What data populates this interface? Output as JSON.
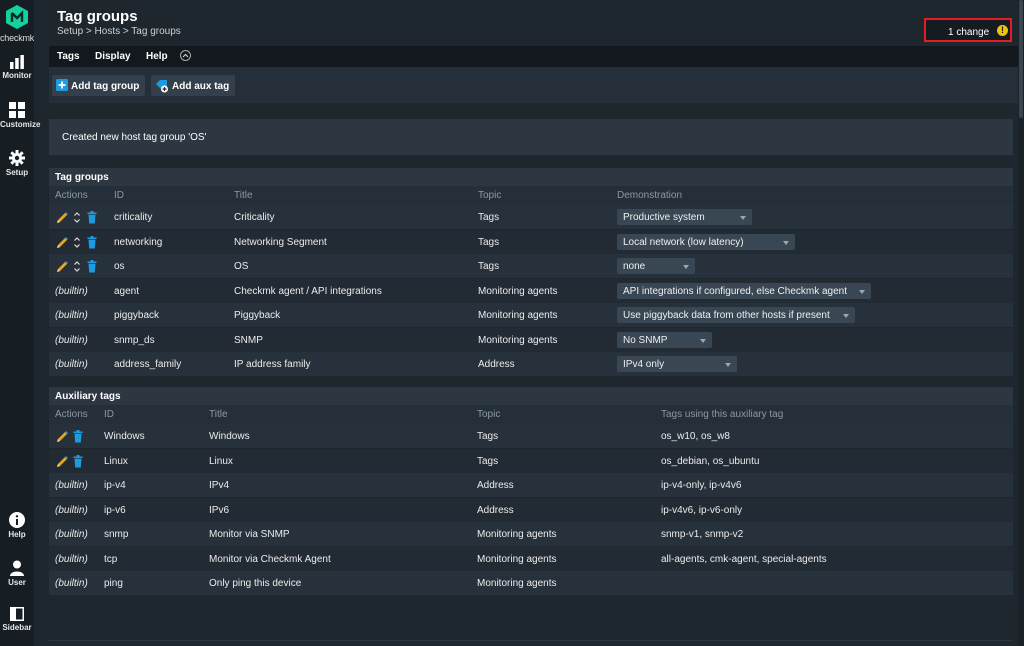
{
  "app": {
    "logo_text": "checkmk",
    "brand_color": "#15d1a0",
    "nav_top": [
      {
        "label": "Monitor",
        "icon": "bar-chart-icon"
      },
      {
        "label": "Customize",
        "icon": "grid-icon"
      },
      {
        "label": "Setup",
        "icon": "gear-icon"
      }
    ],
    "nav_bottom": [
      {
        "label": "Help",
        "icon": "info-icon"
      },
      {
        "label": "User",
        "icon": "user-icon"
      },
      {
        "label": "Sidebar",
        "icon": "sidebar-icon"
      }
    ]
  },
  "header": {
    "title": "Tag groups",
    "breadcrumb": "Setup > Hosts > Tag groups",
    "changes": {
      "label": "1 change",
      "icon": "warning-icon",
      "highlight_color": "#e51c23"
    }
  },
  "menu": [
    "Tags",
    "Display",
    "Help"
  ],
  "toolbar": {
    "add_tag_group": "Add tag group",
    "add_aux_tag": "Add aux tag"
  },
  "message": "Created new host tag group 'OS'",
  "tag_groups": {
    "header": "Tag groups",
    "columns": [
      "Actions",
      "ID",
      "Title",
      "Topic",
      "Demonstration"
    ],
    "rows": [
      {
        "actions": "edit",
        "id": "criticality",
        "title": "Criticality",
        "topic": "Tags",
        "demo": "Productive system"
      },
      {
        "actions": "edit",
        "id": "networking",
        "title": "Networking Segment",
        "topic": "Tags",
        "demo": "Local network (low latency)"
      },
      {
        "actions": "edit",
        "id": "os",
        "title": "OS",
        "topic": "Tags",
        "demo": "none"
      },
      {
        "actions": "(builtin)",
        "id": "agent",
        "title": "Checkmk agent / API integrations",
        "topic": "Monitoring agents",
        "demo": "API integrations if configured, else Checkmk agent"
      },
      {
        "actions": "(builtin)",
        "id": "piggyback",
        "title": "Piggyback",
        "topic": "Monitoring agents",
        "demo": "Use piggyback data from other hosts if present"
      },
      {
        "actions": "(builtin)",
        "id": "snmp_ds",
        "title": "SNMP",
        "topic": "Monitoring agents",
        "demo": "No SNMP"
      },
      {
        "actions": "(builtin)",
        "id": "address_family",
        "title": "IP address family",
        "topic": "Address",
        "demo": "IPv4 only"
      }
    ]
  },
  "aux_tags": {
    "header": "Auxiliary tags",
    "columns": [
      "Actions",
      "ID",
      "Title",
      "Topic",
      "Tags using this auxiliary tag"
    ],
    "rows": [
      {
        "actions": "edit",
        "id": "Windows",
        "title": "Windows",
        "topic": "Tags",
        "used": "os_w10, os_w8"
      },
      {
        "actions": "edit",
        "id": "Linux",
        "title": "Linux",
        "topic": "Tags",
        "used": "os_debian, os_ubuntu"
      },
      {
        "actions": "(builtin)",
        "id": "ip-v4",
        "title": "IPv4",
        "topic": "Address",
        "used": "ip-v4-only, ip-v4v6"
      },
      {
        "actions": "(builtin)",
        "id": "ip-v6",
        "title": "IPv6",
        "topic": "Address",
        "used": "ip-v4v6, ip-v6-only"
      },
      {
        "actions": "(builtin)",
        "id": "snmp",
        "title": "Monitor via SNMP",
        "topic": "Monitoring agents",
        "used": "snmp-v1, snmp-v2"
      },
      {
        "actions": "(builtin)",
        "id": "tcp",
        "title": "Monitor via Checkmk Agent",
        "topic": "Monitoring agents",
        "used": "all-agents, cmk-agent, special-agents"
      },
      {
        "actions": "(builtin)",
        "id": "ping",
        "title": "Only ping this device",
        "topic": "Monitoring agents",
        "used": ""
      }
    ]
  }
}
